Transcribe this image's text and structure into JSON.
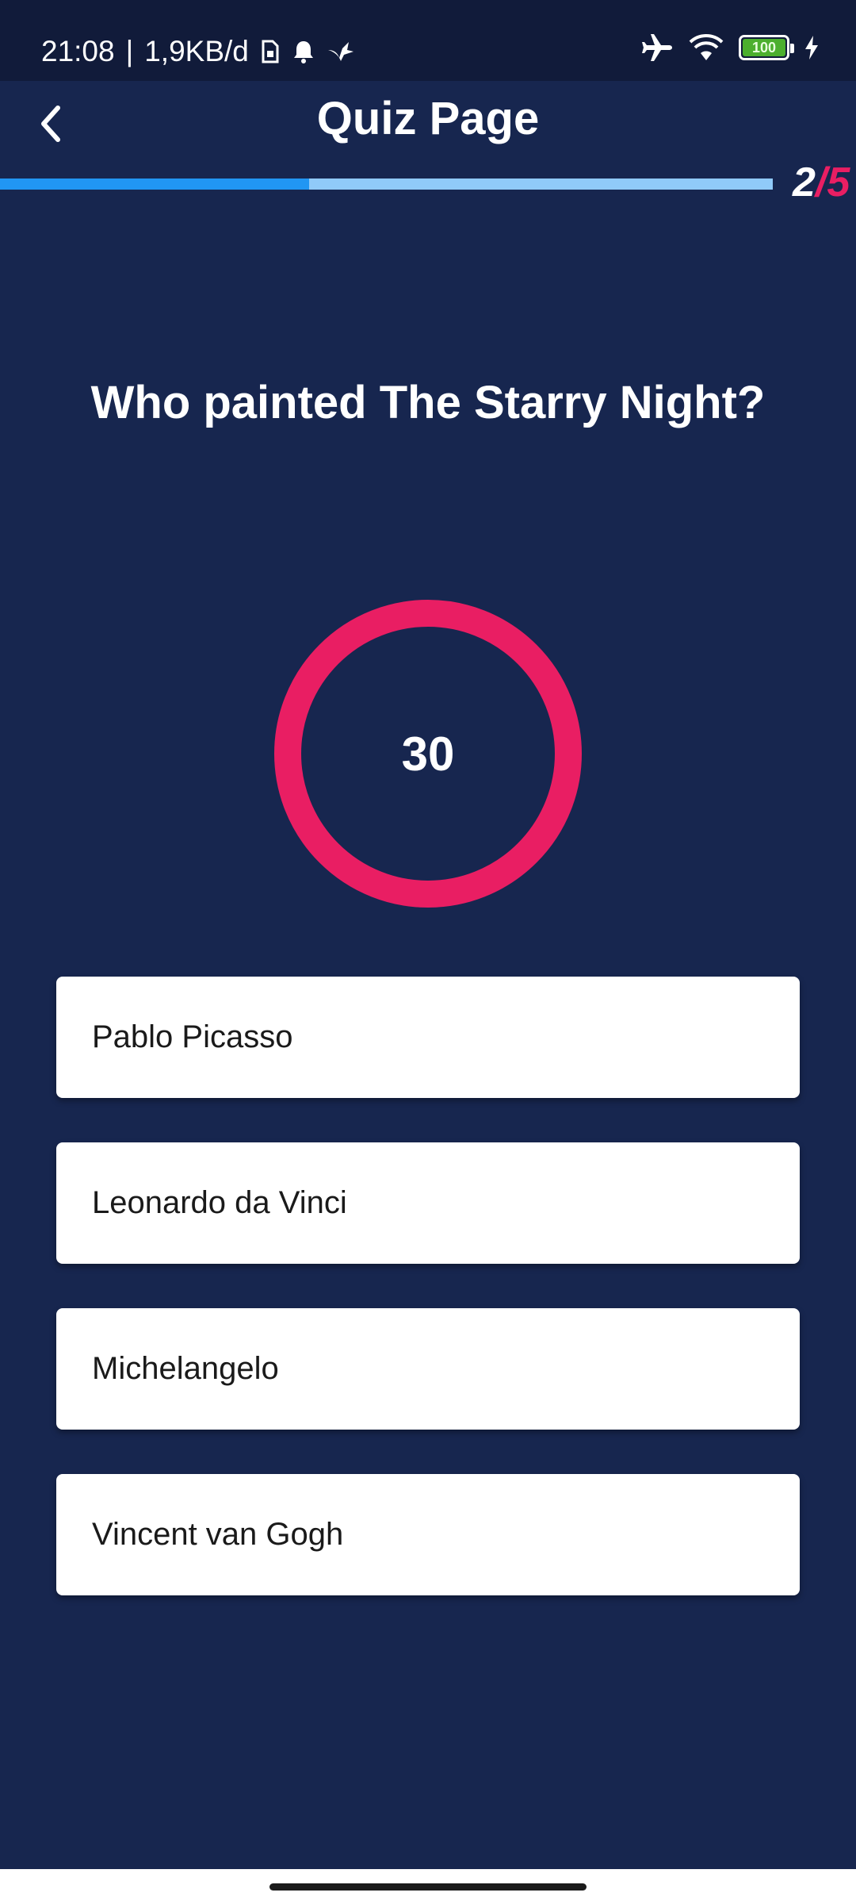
{
  "status_bar": {
    "time": "21:08",
    "separator": "|",
    "network_speed": "1,9KB/d",
    "icons": [
      "sim-icon",
      "bell-icon",
      "bird-icon",
      "airplane-mode-icon",
      "wifi-icon",
      "battery-icon",
      "charging-icon"
    ],
    "battery_level": "100"
  },
  "app_bar": {
    "title": "Quiz Page",
    "back_icon": "chevron-left-icon"
  },
  "progress": {
    "current": "2",
    "total": "/5",
    "fraction": 0.4,
    "fill_color": "#2196f3",
    "track_color": "#90caf9"
  },
  "question": {
    "text": "Who painted The Starry Night?"
  },
  "timer": {
    "value": "30",
    "ring_color": "#e91e63"
  },
  "options": [
    {
      "label": "Pablo Picasso"
    },
    {
      "label": "Leonardo da Vinci"
    },
    {
      "label": "Michelangelo"
    },
    {
      "label": "Vincent van Gogh"
    }
  ],
  "colors": {
    "background": "#17264f",
    "status_bar": "#111b3a",
    "accent": "#e91e63"
  }
}
